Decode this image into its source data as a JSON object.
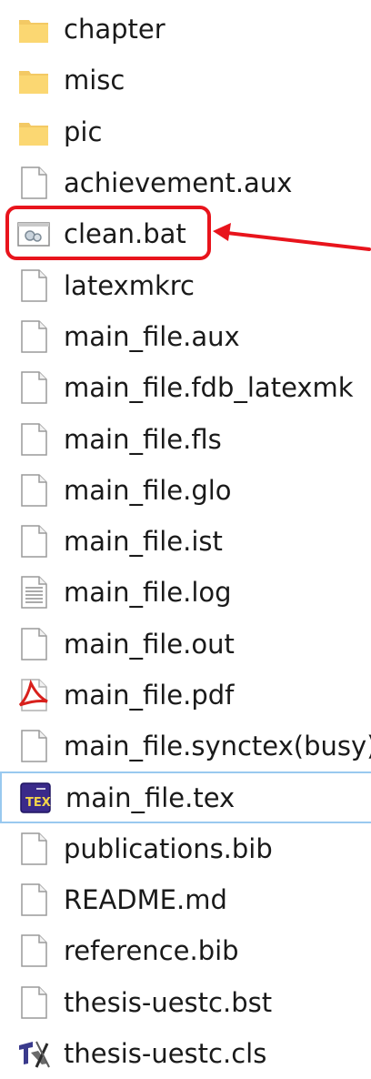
{
  "files": [
    {
      "name": "chapter",
      "icon": "folder-icon"
    },
    {
      "name": "misc",
      "icon": "folder-icon"
    },
    {
      "name": "pic",
      "icon": "folder-icon"
    },
    {
      "name": "achievement.aux",
      "icon": "file-icon"
    },
    {
      "name": "clean.bat",
      "icon": "batch-file-icon"
    },
    {
      "name": "latexmkrc",
      "icon": "file-icon"
    },
    {
      "name": "main_file.aux",
      "icon": "file-icon"
    },
    {
      "name": "main_file.fdb_latexmk",
      "icon": "file-icon"
    },
    {
      "name": "main_file.fls",
      "icon": "file-icon"
    },
    {
      "name": "main_file.glo",
      "icon": "file-icon"
    },
    {
      "name": "main_file.ist",
      "icon": "file-icon"
    },
    {
      "name": "main_file.log",
      "icon": "text-file-icon"
    },
    {
      "name": "main_file.out",
      "icon": "file-icon"
    },
    {
      "name": "main_file.pdf",
      "icon": "pdf-icon"
    },
    {
      "name": "main_file.synctex(busy)",
      "icon": "file-icon"
    },
    {
      "name": "main_file.tex",
      "icon": "tex-icon"
    },
    {
      "name": "publications.bib",
      "icon": "file-icon"
    },
    {
      "name": "README.md",
      "icon": "file-icon"
    },
    {
      "name": "reference.bib",
      "icon": "file-icon"
    },
    {
      "name": "thesis-uestc.bst",
      "icon": "file-icon"
    },
    {
      "name": "thesis-uestc.cls",
      "icon": "tex-cls-icon"
    }
  ],
  "selected_index": 15,
  "annotation": {
    "highlight_color": "#e8141c",
    "target_file_index": 4
  }
}
